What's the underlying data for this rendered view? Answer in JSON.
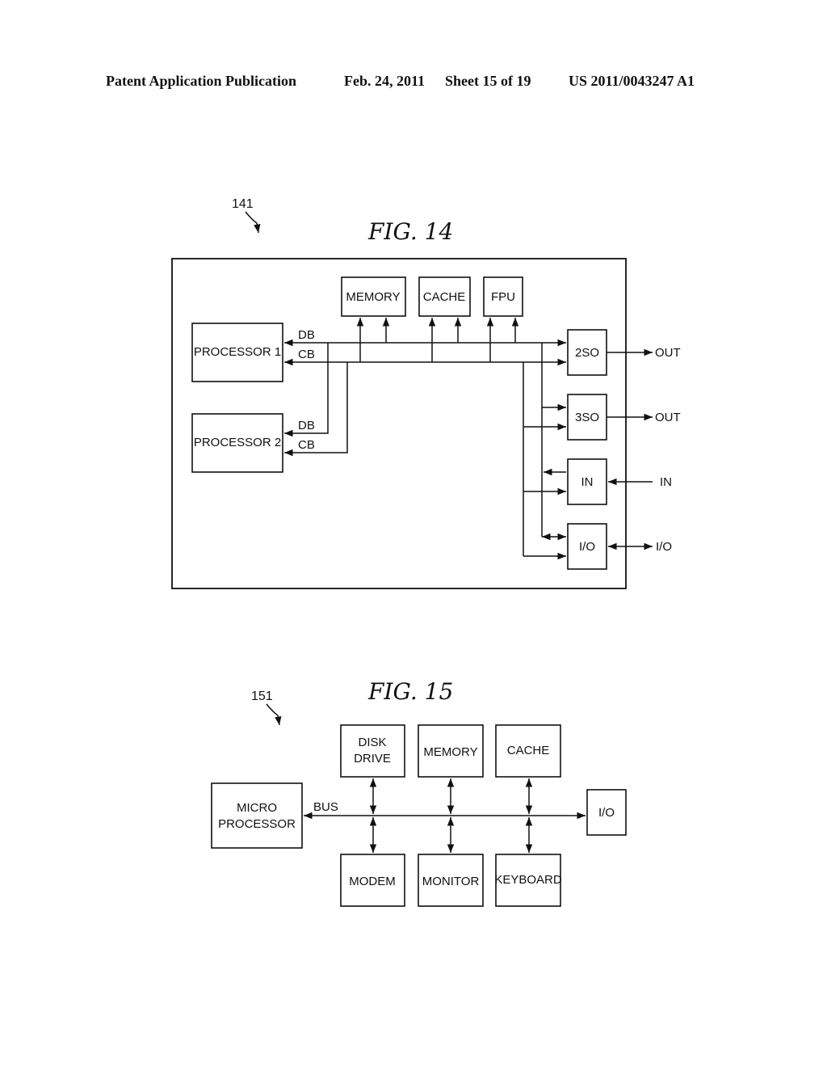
{
  "header": {
    "publication": "Patent Application Publication",
    "date": "Feb. 24, 2011",
    "sheet": "Sheet 15 of 19",
    "number": "US 2011/0043247 A1"
  },
  "fig14": {
    "title": "FIG.  14",
    "ref": "141",
    "blocks": {
      "processor1": "PROCESSOR  1",
      "processor2": "PROCESSOR  2",
      "memory": "MEMORY",
      "cache": "CACHE",
      "fpu": "FPU",
      "sso2": "2SO",
      "sso3": "3SO",
      "in": "IN",
      "io": "I/O"
    },
    "bus_labels": {
      "db1": "DB",
      "cb1": "CB",
      "db2": "DB",
      "cb2": "CB"
    },
    "external": {
      "out1": "OUT",
      "out2": "OUT",
      "in": "IN",
      "io": "I/O"
    }
  },
  "fig15": {
    "title": "FIG.  15",
    "ref": "151",
    "blocks": {
      "microprocessor_line1": "MICRO",
      "microprocessor_line2": "PROCESSOR",
      "disk_line1": "DISK",
      "disk_line2": "DRIVE",
      "memory": "MEMORY",
      "cache": "CACHE",
      "io": "I/O",
      "modem": "MODEM",
      "monitor": "MONITOR",
      "keyboard": "KEYBOARD"
    },
    "bus_label": "BUS"
  }
}
